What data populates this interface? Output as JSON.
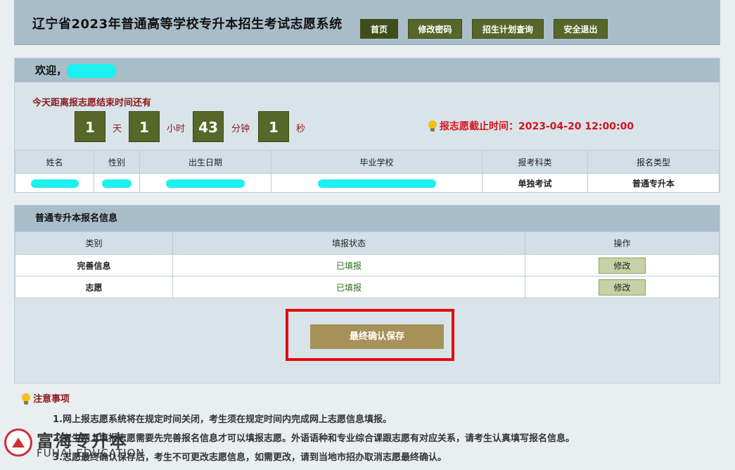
{
  "header": {
    "title": "辽宁省2023年普通高等学校专升本招生考试志愿系统",
    "nav": [
      "首页",
      "修改密码",
      "招生计划查询",
      "安全退出"
    ]
  },
  "welcome": {
    "prefix": "欢迎，",
    "countdown_label": "今天距离报志愿结束时间还有",
    "days": "1",
    "days_unit": "天",
    "hours": "1",
    "hours_unit": "小时",
    "minutes": "43",
    "minutes_unit": "分钟",
    "seconds": "1",
    "seconds_unit": "秒",
    "deadline_label": "报志愿截止时间：",
    "deadline_value": "2023-04-20 12:00:00"
  },
  "student_table": {
    "headers": [
      "姓名",
      "性别",
      "出生日期",
      "毕业学校",
      "报考科类",
      "报名类型"
    ],
    "exam_category": "单独考试",
    "registration_type": "普通专升本"
  },
  "registration": {
    "title": "普通专升本报名信息",
    "headers": [
      "类别",
      "填报状态",
      "操作"
    ],
    "rows": [
      {
        "category": "完善信息",
        "status": "已填报",
        "action": "修改"
      },
      {
        "category": "志愿",
        "status": "已填报",
        "action": "修改"
      }
    ],
    "confirm_button": "最终确认保存"
  },
  "notes": {
    "title": "注意事项",
    "items": [
      "1.网上报志愿系统将在规定时间关闭，考生须在规定时间内完成网上志愿信息填报。",
      "2.考生网上填报志愿需要先完善报名信息才可以填报志愿。外语语种和专业综合课跟志愿有对应关系，请考生认真填写报名信息。",
      "3.志愿最终确认保存后，考生不可更改志愿信息，如需更改，请到当地市招办取消志愿最终确认。"
    ]
  },
  "watermark": {
    "name_cn": "富海专升本",
    "name_en": "FUHAI EDUCATION"
  },
  "colors": {
    "header_bg": "#a9bdc9",
    "button_dark_green": "#57672a",
    "confirm_button": "#a69258",
    "deadline_red": "#d4141c",
    "highlight_box": "#e30d0d"
  }
}
